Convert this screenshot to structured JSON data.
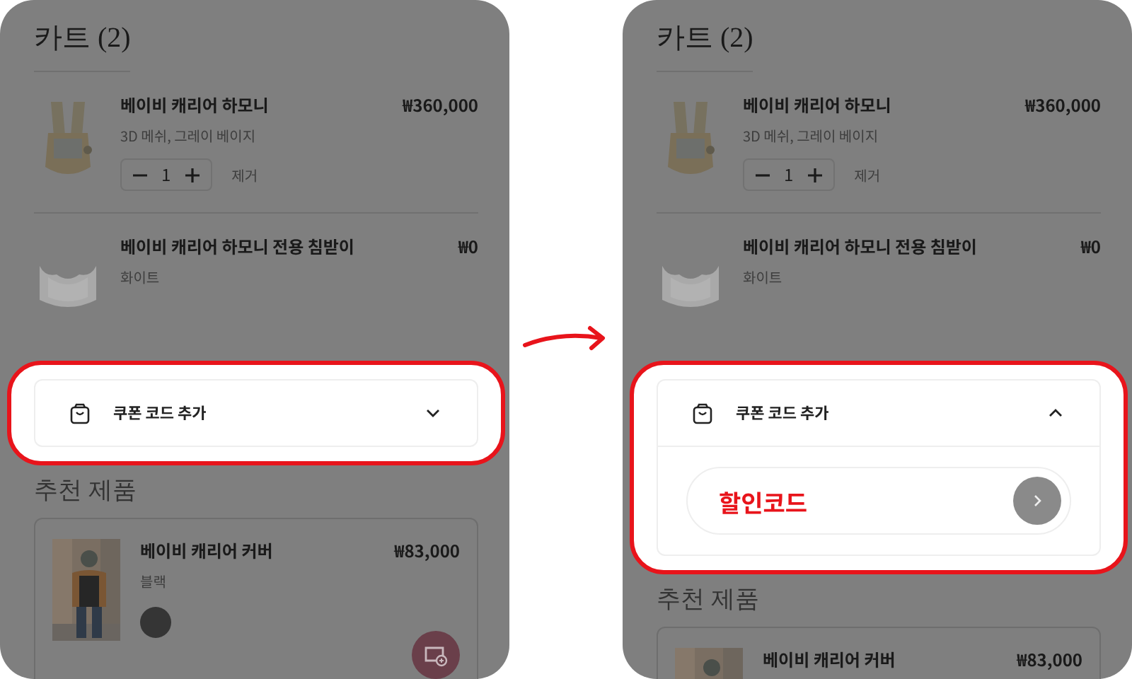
{
  "panels": [
    {
      "title": "카트 (2)",
      "cart_items": [
        {
          "name": "베이비 캐리어 하모니",
          "option": "3D 메쉬, 그레이 베이지",
          "price": "₩360,000",
          "quantity": "1",
          "remove": "제거",
          "kind": "carrier"
        },
        {
          "name": "베이비 캐리어 하모니 전용 침받이",
          "option": "화이트",
          "price": "₩0",
          "kind": "bib"
        }
      ],
      "coupon": {
        "label": "쿠폰 코드 추가",
        "expanded": false
      },
      "recommended": {
        "title": "추천 제품",
        "items": [
          {
            "name": "베이비 캐리어 커버",
            "option": "블랙",
            "price": "₩83,000",
            "color": "#353535"
          }
        ]
      }
    },
    {
      "title": "카트 (2)",
      "cart_items": [
        {
          "name": "베이비 캐리어 하모니",
          "option": "3D 메쉬, 그레이 베이지",
          "price": "₩360,000",
          "quantity": "1",
          "remove": "제거",
          "kind": "carrier"
        },
        {
          "name": "베이비 캐리어 하모니 전용 침받이",
          "option": "화이트",
          "price": "₩0",
          "kind": "bib"
        }
      ],
      "coupon": {
        "label": "쿠폰 코드 추가",
        "expanded": true,
        "code": "할인코드"
      },
      "recommended": {
        "title": "추천 제품",
        "items": [
          {
            "name": "베이비 캐리어 커버",
            "price": "₩83,000"
          }
        ]
      }
    }
  ]
}
